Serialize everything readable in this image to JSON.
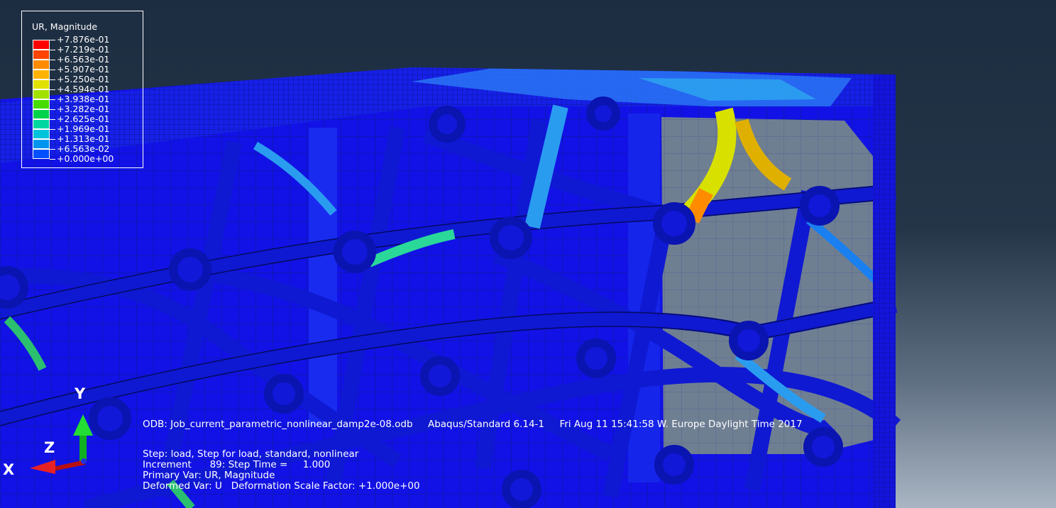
{
  "legend": {
    "title": "UR, Magnitude",
    "entries": [
      {
        "label": "+7.876e-01",
        "color": "#ff0000"
      },
      {
        "label": "+7.219e-01",
        "color": "#ff4500"
      },
      {
        "label": "+6.563e-01",
        "color": "#ff8c00"
      },
      {
        "label": "+5.907e-01",
        "color": "#ffb300"
      },
      {
        "label": "+5.250e-01",
        "color": "#e1e100"
      },
      {
        "label": "+4.594e-01",
        "color": "#a2e100"
      },
      {
        "label": "+3.938e-01",
        "color": "#46dc00"
      },
      {
        "label": "+3.282e-01",
        "color": "#00d24b"
      },
      {
        "label": "+2.625e-01",
        "color": "#00d7a0"
      },
      {
        "label": "+1.969e-01",
        "color": "#00c3dc"
      },
      {
        "label": "+1.313e-01",
        "color": "#0096f0"
      },
      {
        "label": "+6.563e-02",
        "color": "#0050ff"
      },
      {
        "label": "+0.000e+00",
        "color": ""
      }
    ]
  },
  "info": {
    "odb_line": "ODB: Job_current_parametric_nonlinear_damp2e-08.odb     Abaqus/Standard 6.14-1     Fri Aug 11 15:41:58 W. Europe Daylight Time 2017",
    "step": "Step: load, Step for load, standard, nonlinear",
    "increment": "Increment      89: Step Time =     1.000",
    "primary_var": "Primary Var: UR, Magnitude",
    "deformed_var": "Deformed Var: U   Deformation Scale Factor: +1.000e+00"
  },
  "triad": {
    "y_label": "Y",
    "z_label": "Z",
    "x_label": "X"
  }
}
